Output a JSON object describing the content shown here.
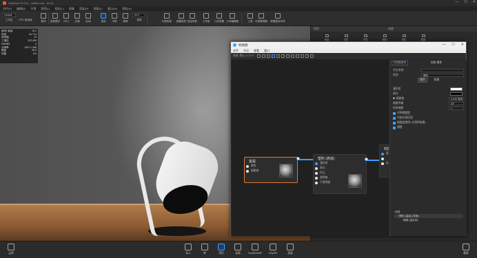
{
  "titlebar": {
    "title": "KeyShot 9.0 Pro - untitled.bip - 64 bit"
  },
  "menubar": [
    "文件(F)",
    "编辑(E)",
    "环境",
    "照明(L)",
    "相机(C)",
    "图像",
    "渲染(R)",
    "视图(V)",
    "窗口(W)",
    "帮助(H)"
  ],
  "toolbar": {
    "workspace_select": "Default",
    "zoom_value": "50.0",
    "items": [
      "工作区",
      "CPU 使用量",
      "暂停",
      "性能模式",
      "GPU",
      "去噪",
      "区域",
      "渲染",
      "平移",
      "推移",
      "视角",
      "切换相机",
      "重置相机",
      "锁定相机",
      "工作室",
      "几何视图",
      "几何编辑器",
      "工具",
      "光源管理器",
      "配置程序向导"
    ]
  },
  "stats": [
    [
      "帧/秒 每帧",
      "19.1"
    ],
    [
      "时间",
      "9s 714"
    ],
    [
      "采样值",
      "12"
    ],
    [
      "三角形",
      "123,459"
    ],
    [
      "NURBS",
      "0"
    ],
    [
      "分辨率",
      "1397 x 466"
    ],
    [
      "焦距",
      "25.0"
    ],
    [
      "亮度",
      "6.6"
    ]
  ],
  "right_panel": {
    "header_left": "项目",
    "header_right": "材质",
    "tabs": [
      "场景",
      "材质",
      "环境",
      "照明",
      "相机",
      "图像"
    ]
  },
  "material_window": {
    "title": "材质图",
    "menu": [
      "文件",
      "节点",
      "查看",
      "窗口"
    ],
    "toolbar_label": "纹理: 默认 0.0 0.0",
    "nodes": {
      "metal": {
        "title": "金属",
        "ports": [
          "颜色",
          "粗糙度"
        ]
      },
      "plastic": {
        "title": "塑料 (高级)",
        "ports": [
          "漫反射",
          "高光",
          "凹凸",
          "透明度",
          "不透明度"
        ]
      },
      "material": {
        "title": "材质",
        "ports": [
          "表面",
          "",
          "标签"
        ]
      }
    }
  },
  "properties": {
    "breadcrumb": "材质图菜单",
    "section_label": "材质  属性",
    "name_label": "节点名称:",
    "type_label": "类型:",
    "type_value": "塑料",
    "tabs": [
      "属性",
      "纹理"
    ],
    "rows": [
      {
        "label": "漫反射",
        "kind": "swatch",
        "color": "#ffffff"
      },
      {
        "label": "高光",
        "kind": "swatch",
        "color": "#000000"
      },
      {
        "label": "▶ 粗糙度",
        "kind": "field",
        "value": "0.000 毫米"
      },
      {
        "label": "粗糙传输",
        "kind": "field",
        "value": "45°"
      },
      {
        "label": "折射指数",
        "kind": "field",
        "value": "1"
      }
    ],
    "checkboxes": [
      "对称粗糙度",
      "内部光线匹配",
      "粗糙度透明 (半透明效果)",
      "薄壁"
    ],
    "tree": [
      "材质",
      "塑料 (高级) (表面)",
      "粗糙 (漫反射)"
    ]
  },
  "bottombar": {
    "left": "云库",
    "items": [
      "导入",
      "库",
      "项目",
      "动画",
      "KeyShotXR",
      "KeyVR",
      "渲染"
    ],
    "right": "截屏"
  },
  "colors": {
    "accent": "#3aa0ff",
    "selected_node": "#e07a3a"
  }
}
